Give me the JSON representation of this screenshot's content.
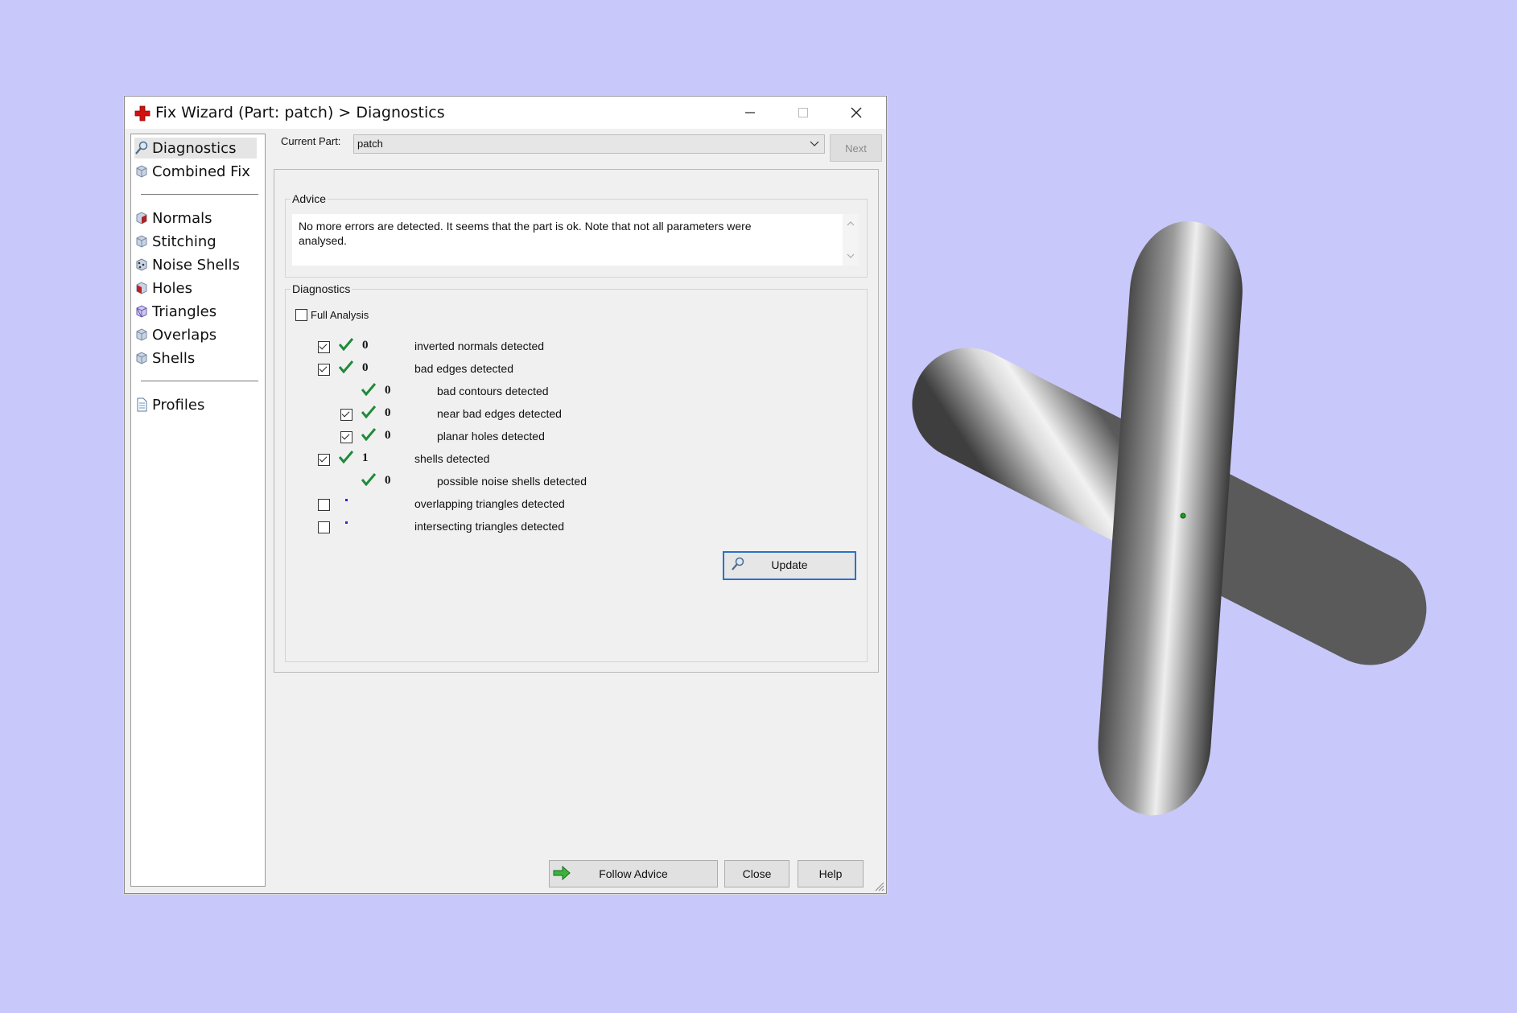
{
  "window": {
    "title": "Fix Wizard (Part: patch) > Diagnostics",
    "minimize_glyph": "—",
    "maximize_glyph": "☐",
    "close_glyph": "✕"
  },
  "sidebar": {
    "items": [
      {
        "label": "Diagnostics",
        "icon": "magnifier-icon",
        "selected": true
      },
      {
        "label": "Combined Fix",
        "icon": "cube-icon"
      },
      {
        "label": "Normals",
        "icon": "normals-cube-icon"
      },
      {
        "label": "Stitching",
        "icon": "stitching-cube-icon"
      },
      {
        "label": "Noise Shells",
        "icon": "noise-shells-icon"
      },
      {
        "label": "Holes",
        "icon": "holes-cube-icon"
      },
      {
        "label": "Triangles",
        "icon": "triangles-cube-icon"
      },
      {
        "label": "Overlaps",
        "icon": "overlaps-cube-icon"
      },
      {
        "label": "Shells",
        "icon": "shells-cube-icon"
      },
      {
        "label": "Profiles",
        "icon": "document-icon"
      }
    ]
  },
  "toolbar": {
    "current_part_label": "Current Part:",
    "current_part_value": "patch",
    "next_label": "Next"
  },
  "advice": {
    "group_label": "Advice",
    "text": "No more errors are detected. It seems that the part is ok. Note that not all parameters were analysed."
  },
  "diagnostics": {
    "group_label": "Diagnostics",
    "full_analysis_label": "Full Analysis",
    "full_analysis_checked": false,
    "rows": [
      {
        "checked": true,
        "status": "ok",
        "count": "0",
        "label": "inverted normals detected",
        "indent": 0,
        "has_checkbox": true
      },
      {
        "checked": true,
        "status": "ok",
        "count": "0",
        "label": "bad edges detected",
        "indent": 0,
        "has_checkbox": true
      },
      {
        "checked": false,
        "status": "ok",
        "count": "0",
        "label": "bad contours detected",
        "indent": 1,
        "has_checkbox": false
      },
      {
        "checked": true,
        "status": "ok",
        "count": "0",
        "label": "near bad edges detected",
        "indent": 1,
        "has_checkbox": true
      },
      {
        "checked": true,
        "status": "ok",
        "count": "0",
        "label": "planar holes detected",
        "indent": 1,
        "has_checkbox": true
      },
      {
        "checked": true,
        "status": "ok",
        "count": "1",
        "label": "shells detected",
        "indent": 0,
        "has_checkbox": true
      },
      {
        "checked": false,
        "status": "ok",
        "count": "0",
        "label": "possible noise shells detected",
        "indent": 1,
        "has_checkbox": false
      },
      {
        "checked": false,
        "status": "pending",
        "count": "",
        "label": "overlapping triangles detected",
        "indent": 0,
        "has_checkbox": true
      },
      {
        "checked": false,
        "status": "pending",
        "count": "",
        "label": "intersecting triangles detected",
        "indent": 0,
        "has_checkbox": true
      }
    ],
    "update_label": "Update"
  },
  "footer": {
    "follow_advice_label": "Follow Advice",
    "close_label": "Close",
    "help_label": "Help"
  },
  "colors": {
    "background": "#c8c8fa",
    "tick_green": "#1f8a3a",
    "accent_blue": "#2a72c8"
  }
}
